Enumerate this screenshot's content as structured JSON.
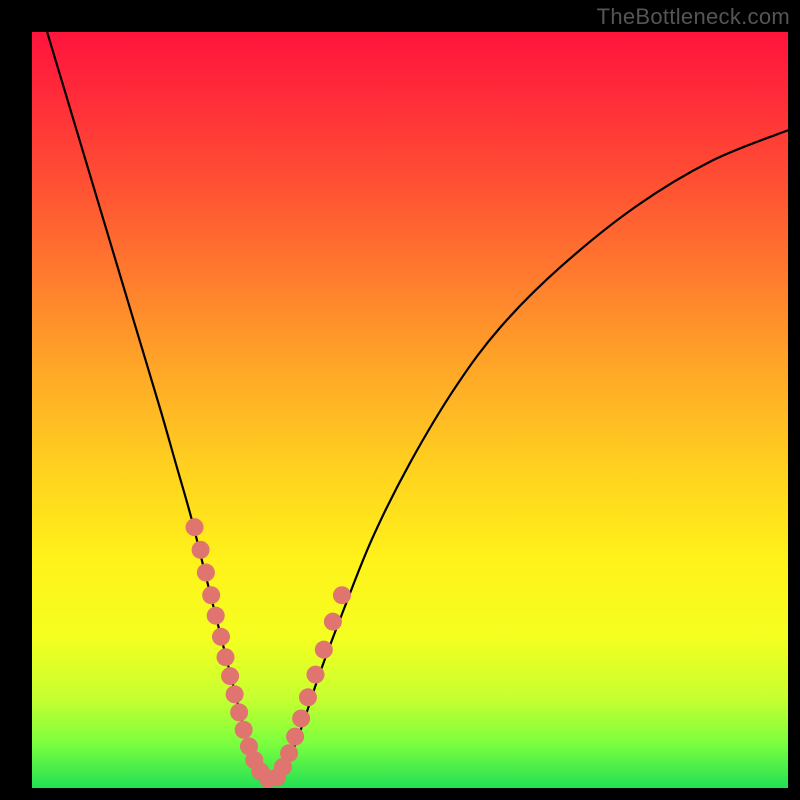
{
  "watermark": "TheBottleneck.com",
  "colors": {
    "frame": "#000000",
    "curve": "#000000",
    "dot": "#e0746f",
    "gradient_stops": [
      "#ff143c",
      "#ff2a3a",
      "#ff5033",
      "#ff7a2e",
      "#ffa528",
      "#ffd21f",
      "#fff21a",
      "#f4ff20",
      "#c8ff30",
      "#7dff3e",
      "#22e055"
    ]
  },
  "chart_data": {
    "type": "line",
    "title": "",
    "xlabel": "",
    "ylabel": "",
    "xlim": [
      0,
      100
    ],
    "ylim": [
      0,
      100
    ],
    "series": [
      {
        "name": "bottleneck-curve",
        "x": [
          2,
          5,
          8,
          11,
          14,
          17,
          19,
          21,
          22.5,
          24,
          25.5,
          27,
          28,
          29,
          30,
          31,
          32,
          33,
          34.5,
          36,
          38,
          41,
          45,
          50,
          56,
          62,
          70,
          80,
          90,
          100
        ],
        "y": [
          100,
          90,
          80,
          70,
          60,
          50,
          43,
          36,
          30,
          24,
          18,
          12,
          8,
          5,
          2.5,
          1,
          1,
          2.5,
          5,
          9,
          15,
          23,
          33,
          43,
          53,
          61,
          69,
          77,
          83,
          87
        ]
      }
    ],
    "highlight_points": {
      "name": "dot-cluster",
      "x": [
        21.5,
        22.3,
        23.0,
        23.7,
        24.3,
        25.0,
        25.6,
        26.2,
        26.8,
        27.4,
        28.0,
        28.7,
        29.4,
        30.2,
        31.2,
        32.4,
        33.2,
        34.0,
        34.8,
        35.6,
        36.5,
        37.5,
        38.6,
        39.8,
        41.0
      ],
      "y": [
        34.5,
        31.5,
        28.5,
        25.5,
        22.8,
        20.0,
        17.3,
        14.8,
        12.4,
        10.0,
        7.7,
        5.5,
        3.7,
        2.2,
        1.2,
        1.4,
        2.8,
        4.6,
        6.8,
        9.2,
        12.0,
        15.0,
        18.3,
        22.0,
        25.5
      ]
    }
  }
}
